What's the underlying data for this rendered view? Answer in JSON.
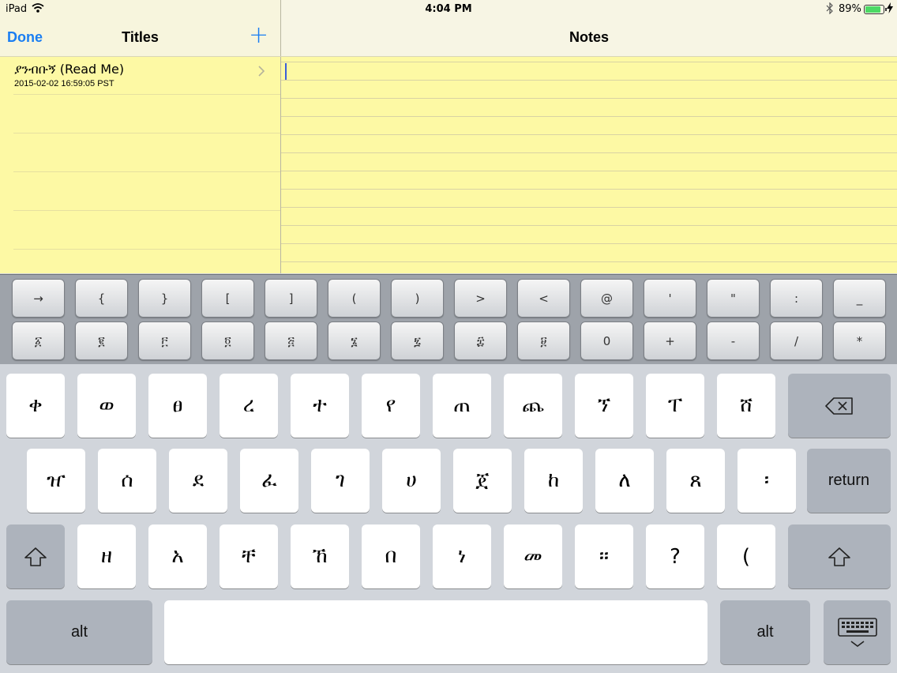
{
  "status_bar": {
    "device": "iPad",
    "time": "4:04 PM",
    "battery": "89%",
    "battery_level": 0.89
  },
  "titles_panel": {
    "done_label": "Done",
    "title": "Titles",
    "add_label": "+",
    "notes": [
      {
        "title": "ያንብቡኝ (Read Me)",
        "date": "2015-02-02 16:59:05 PST"
      }
    ]
  },
  "notes_panel": {
    "title": "Notes",
    "text": ""
  },
  "extra_keys": {
    "row1": [
      "→",
      "{",
      "}",
      "[",
      "]",
      "(",
      ")",
      ">",
      "<",
      "@",
      "'",
      "\"",
      ":",
      "_"
    ],
    "row2": [
      "፩",
      "፪",
      "፫",
      "፬",
      "፭",
      "፮",
      "፯",
      "፰",
      "፱",
      "0",
      "+",
      "-",
      "/",
      "*"
    ]
  },
  "keyboard": {
    "row1": [
      "ቀ",
      "ወ",
      "ፀ",
      "ረ",
      "ተ",
      "የ",
      "ጠ",
      "ጨ",
      "ኘ",
      "ፐ",
      "ሸ"
    ],
    "row2": [
      "ዠ",
      "ሰ",
      "ደ",
      "ፈ",
      "ገ",
      "ሀ",
      "ጀ",
      "ከ",
      "ለ",
      "ጸ",
      "፡"
    ],
    "row3": [
      "ዘ",
      "አ",
      "ቸ",
      "ኸ",
      "በ",
      "ነ",
      "መ",
      "።",
      "?",
      "("
    ],
    "return_label": "return",
    "alt_label": "alt",
    "space_label": ""
  }
}
